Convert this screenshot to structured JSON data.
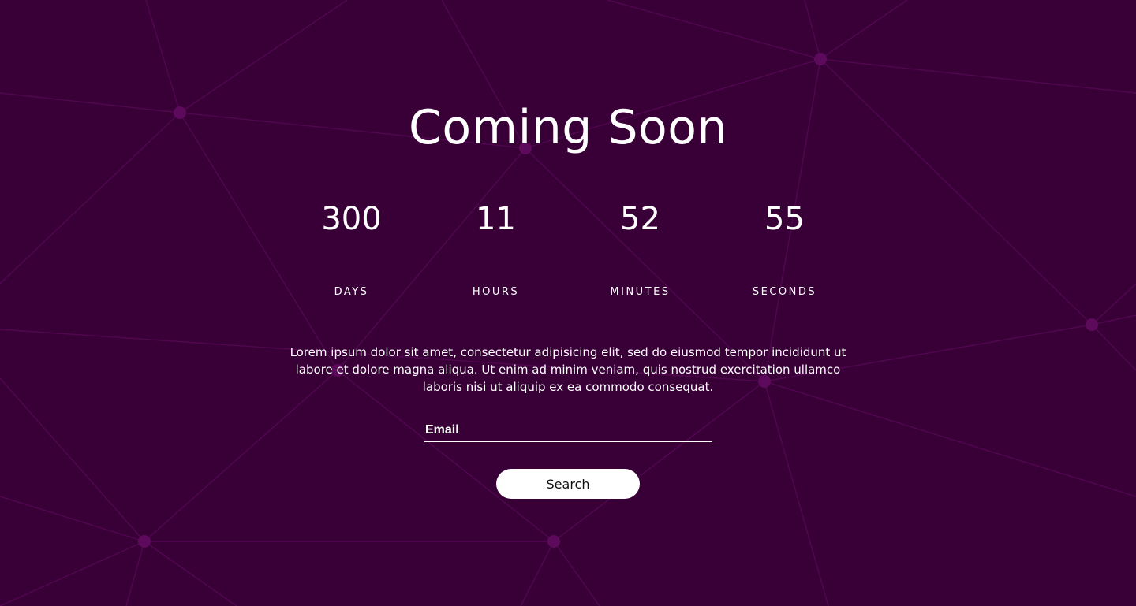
{
  "page": {
    "title": "Coming Soon",
    "description": "Lorem ipsum dolor sit amet, consectetur adipisicing elit, sed do eiusmod tempor incididunt ut labore et dolore magna aliqua. Ut enim ad minim veniam, quis nostrud exercitation ullamco laboris nisi ut aliquip ex ea commodo consequat."
  },
  "countdown": [
    {
      "value": "300",
      "label": "DAYS"
    },
    {
      "value": "11",
      "label": "HOURS"
    },
    {
      "value": "52",
      "label": "MINUTES"
    },
    {
      "value": "55",
      "label": "SECONDS"
    }
  ],
  "form": {
    "email_placeholder": "Email",
    "email_value": "",
    "search_label": "Search"
  },
  "colors": {
    "background": "#390038",
    "network_line": "#5a0a58",
    "network_node": "#5e0a5c",
    "text": "#ffffff",
    "button_bg": "#ffffff",
    "button_text": "#111111"
  }
}
